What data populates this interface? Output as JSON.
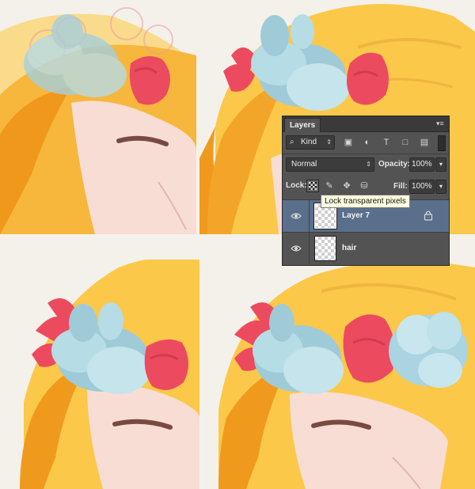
{
  "layers_panel": {
    "tab_label": "Layers",
    "filter": {
      "value": "Kind"
    },
    "blend_mode": {
      "value": "Normal"
    },
    "opacity": {
      "label": "Opacity:",
      "value": "100%"
    },
    "lock": {
      "label": "Lock:"
    },
    "fill": {
      "label": "Fill:",
      "value": "100%"
    },
    "tooltip": "Lock transparent pixels",
    "layers": [
      {
        "name": "Layer 7",
        "selected": true,
        "locked_transparency": true
      },
      {
        "name": "hair",
        "selected": false,
        "locked_transparency": false
      }
    ]
  },
  "colors": {
    "background": "#f4f1ea",
    "hair_light": "#fbc84a",
    "hair_dark": "#ef9a1d",
    "skin": "#f7dcd3",
    "eyebrow": "#7a4a42",
    "flower_blue": "#b6dce6",
    "flower_blue_dark": "#8dc2d1",
    "flower_red": "#ec4b5f",
    "panel_bg": "#535353",
    "selection": "#5a6f8c",
    "tooltip_bg": "#ffffe1"
  }
}
